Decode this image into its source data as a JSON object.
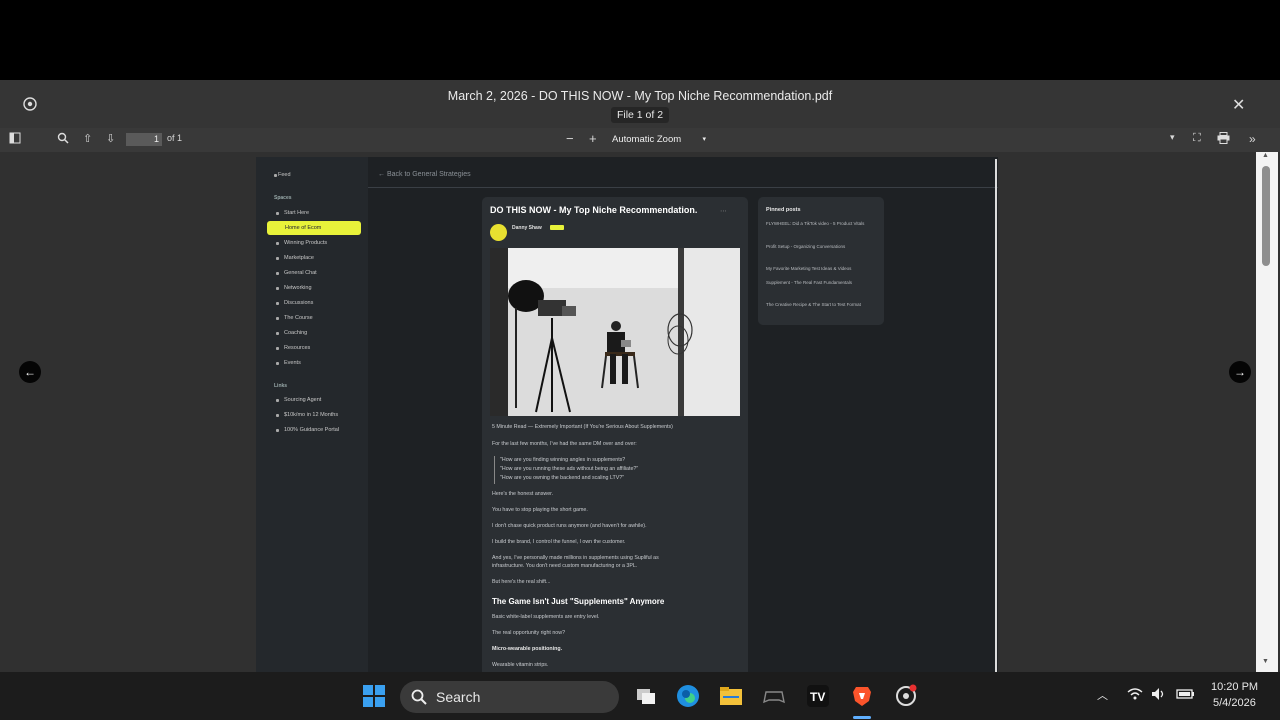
{
  "viewer": {
    "title": "March 2, 2026 - DO THIS NOW - My Top Niche Recommendation.pdf",
    "file_indicator": "File 1 of 2",
    "page_number": "1",
    "page_total": "of 1",
    "zoom": "Automatic Zoom"
  },
  "sidebar": {
    "top": "Feed",
    "section1": "Spaces",
    "items": [
      "Start Here",
      "Home of Ecom",
      "Winning Products",
      "Marketplace",
      "General Chat",
      "Networking",
      "Discussions",
      "The Course",
      "Coaching",
      "Resources",
      "Events"
    ],
    "section2": "Links",
    "links": [
      "Sourcing Agent",
      "$10k/mo in 12 Months",
      "100% Guidance Portal"
    ]
  },
  "content": {
    "back_link": "← Back to General Strategies",
    "post_title": "DO THIS NOW - My Top Niche Recommendation.",
    "author": "Danny Shaw",
    "paragraphs": [
      "5 Minute Read — Extremely Important (If You're Serious About Supplements)",
      "For the last few months, I've had the same DM over and over:",
      "\"How are you finding winning angles in supplements?",
      "\"How are you running these ads without being an affiliate?\"",
      "\"How are you owning the backend and scaling LTV?\"",
      "Here's the honest answer.",
      "You have to stop playing the short game.",
      "I don't chase quick product runs anymore (and haven't for awhile).",
      "I build the brand, I control the funnel, I own the customer.",
      "And yes, I've personally made millions in supplements using Supliful as",
      "infrastructure. You don't need custom manufacturing or a 3PL.",
      "But here's the real shift..."
    ],
    "subhead": "The Game Isn't Just \"Supplements\" Anymore",
    "paragraphs2": [
      "Basic white-label supplements are entry level.",
      "The real opportunity right now?",
      "Micro-wearable positioning.",
      "Wearable vitamin strips."
    ]
  },
  "pinned": {
    "heading": "Pinned posts",
    "items": [
      "FLYWHEEL: Did a TikTok video - 5 Product Vitals",
      "Profit Setup - Organizing Conversations",
      "My Favorite Marketing Test Ideas & Videos",
      "Supplement - The Real Fast Fundamentals",
      "The Creative Recipe & The Start to Test Format"
    ]
  },
  "taskbar": {
    "search_placeholder": "Search",
    "time": "10:20 PM",
    "date": "5/4/2026"
  },
  "colors": {
    "accent": "#e8f23a",
    "viewer_bg": "#303030",
    "page_bg": "#1e2124"
  }
}
